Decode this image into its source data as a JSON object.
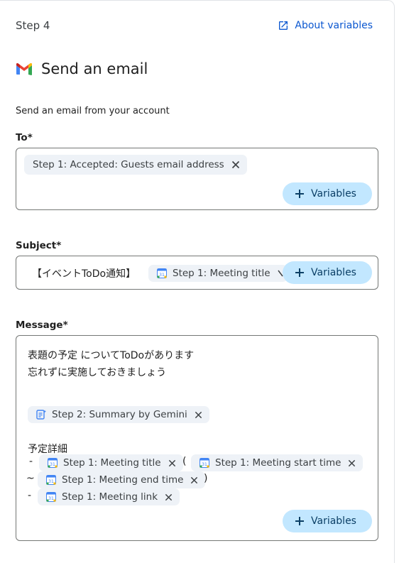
{
  "header": {
    "step": "Step 4",
    "about_link": "About variables"
  },
  "action": {
    "title": "Send an email",
    "description": "Send an email from your account"
  },
  "to": {
    "label": "To*",
    "chips": [
      "Step 1: Accepted: Guests email address"
    ],
    "variables_button": "Variables"
  },
  "subject": {
    "label": "Subject*",
    "prefix_text": "【イベントToDo通知】",
    "chip": "Step 1: Meeting title",
    "variables_button": "Variables"
  },
  "message": {
    "label": "Message*",
    "line1": "表題の予定 についてToDoがあります",
    "line2": "忘れずに実施しておきましょう",
    "gemini_chip": "Step 2: Summary by Gemini",
    "details_heading": "予定詳細",
    "dash1": "-",
    "title_chip": "Step 1: Meeting title",
    "open_paren": "(",
    "start_chip": "Step 1: Meeting start time",
    "tilde": "~",
    "end_chip": "Step 1: Meeting end time",
    "close_paren": ")",
    "dash2": "-",
    "link_chip": "Step 1: Meeting link",
    "variables_button": "Variables"
  },
  "colors": {
    "accent": "#0b57d0",
    "button_bg": "#c2e7ff",
    "chip_bg": "#eef2f7",
    "border": "#747775"
  }
}
